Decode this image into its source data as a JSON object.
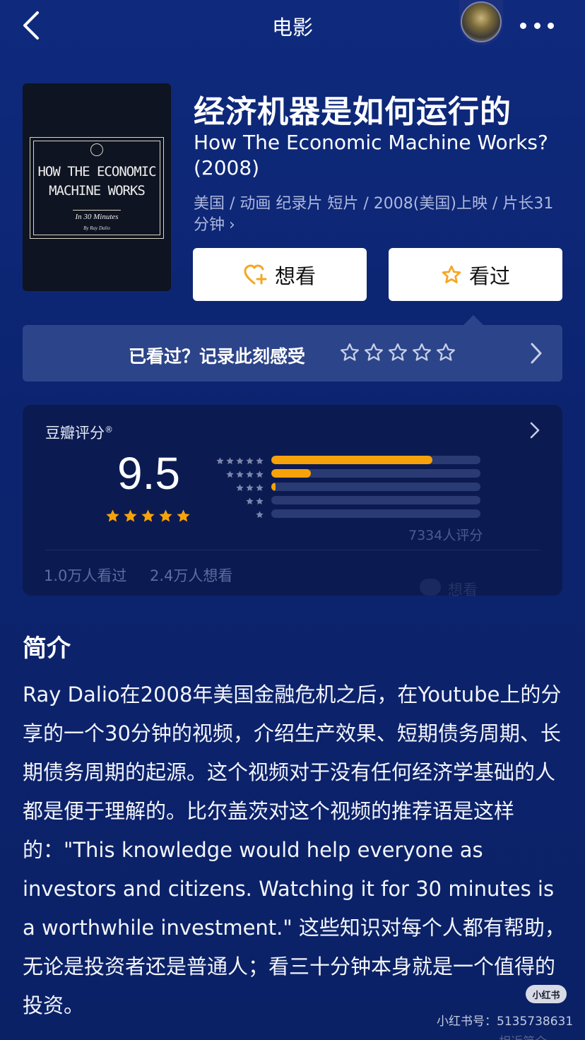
{
  "header": {
    "title": "电影",
    "back_icon": "chevron-left-icon",
    "more_icon": "more-dots-icon"
  },
  "poster": {
    "line1": "HOW THE ECONOMIC",
    "line2": "MACHINE WORKS",
    "subtitle": "In 30 Minutes",
    "byline": "By Ray Dalio"
  },
  "movie": {
    "title_cn": "经济机器是如何运行的",
    "title_en": "How The Economic Machine Works? (2008)",
    "meta": "美国 / 动画 纪录片 短片 / 2008(美国)上映 / 片长31分钟",
    "meta_more": "›"
  },
  "actions": {
    "want_label": "想看",
    "seen_label": "看过"
  },
  "record": {
    "prompt": "已看过？记录此刻感受",
    "stars": 5
  },
  "rating": {
    "label": "豆瓣评分",
    "registered_mark": "®",
    "score": "9.5",
    "stars": 5,
    "distribution": [
      {
        "stars": 5,
        "fraction": 0.77
      },
      {
        "stars": 4,
        "fraction": 0.19
      },
      {
        "stars": 3,
        "fraction": 0.02
      },
      {
        "stars": 2,
        "fraction": 0.0
      },
      {
        "stars": 1,
        "fraction": 0.0
      }
    ],
    "count": "7334人评分",
    "seen": "1.0万人看过",
    "want": "2.4万人想看",
    "ghost_text": "想看"
  },
  "intro": {
    "heading": "简介",
    "body": "Ray Dalio在2008年美国金融危机之后，在Youtube上的分享的一个30分钟的视频，介绍生产效果、短期债务周期、长期债务周期的起源。这个视频对于没有任何经济学基础的人都是便于理解的。比尔盖茨对这个视频的推荐语是这样的：\"This knowledge would help everyone as investors and citizens. Watching it for 30 minutes is a worthwhile investment.\" 这些知识对每个人都有帮助，无论是投资者还是普通人；看三十分钟本身就是一个值得的投资。"
  },
  "watermark": {
    "badge": "小红书",
    "text": "小红书号：5135738631",
    "cut_text": "相近简介"
  },
  "colors": {
    "background": "#0d2572",
    "accent_star": "#f7a20a",
    "card": "#0b1b52",
    "record_bar": "#2c4489"
  }
}
